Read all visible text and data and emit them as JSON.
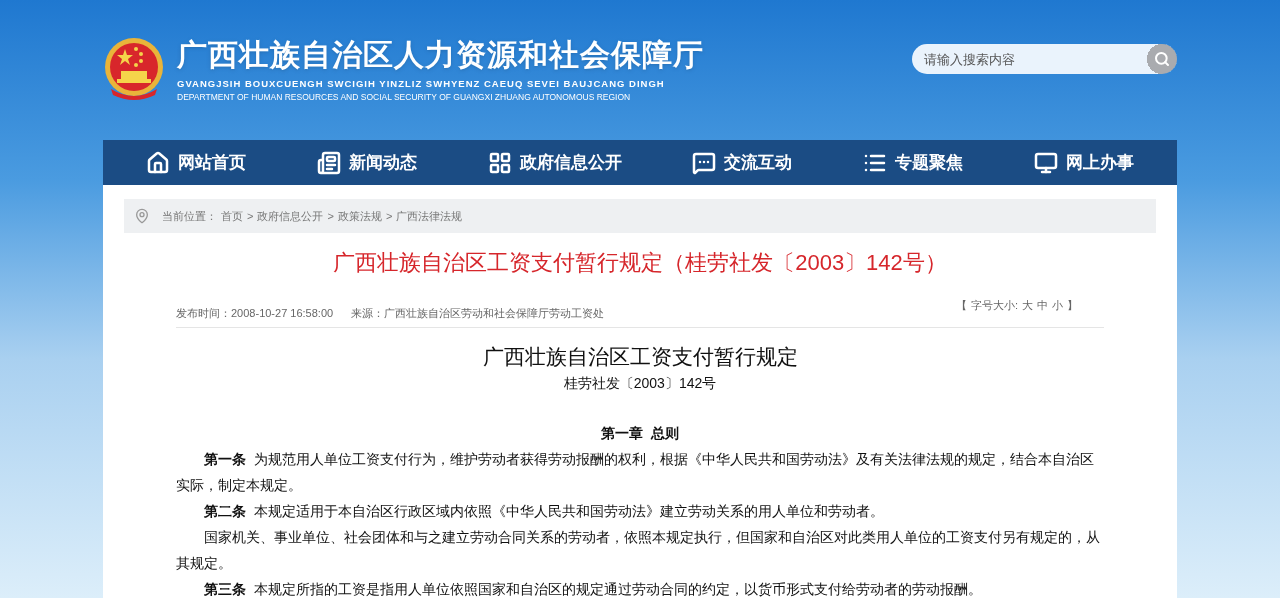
{
  "header": {
    "title": "广西壮族自治区人力资源和社会保障厅",
    "subtitle_zhuang": "GVANGJSIH BOUXCUENGH SWCIGIH YINZLIZ SWHYENZ CAEUQ SEVEI BAUJCANG DINGH",
    "subtitle_en": "DEPARTMENT OF HUMAN RESOURCES AND SOCIAL SECURITY OF GUANGXI ZHUANG AUTONOMOUS REGION"
  },
  "search": {
    "placeholder": "请输入搜索内容"
  },
  "nav": [
    {
      "label": "网站首页",
      "kind": "home"
    },
    {
      "label": "新闻动态",
      "kind": "news"
    },
    {
      "label": "政府信息公开",
      "kind": "grid"
    },
    {
      "label": "交流互动",
      "kind": "chat"
    },
    {
      "label": "专题聚焦",
      "kind": "list"
    },
    {
      "label": "网上办事",
      "kind": "monitor"
    }
  ],
  "breadcrumb": {
    "prefix": "当前位置：",
    "items": [
      {
        "label": "首页"
      },
      {
        "separator": ">",
        "label": "政府信息公开"
      },
      {
        "separator": ">",
        "label": "政策法规"
      },
      {
        "separator": ">",
        "label": "广西法律法规"
      }
    ]
  },
  "article": {
    "title": "广西壮族自治区工资支付暂行规定（桂劳社发〔2003〕142号）",
    "published": "发布时间：2008-10-27 16:58:00",
    "source": "来源：广西壮族自治区劳动和社会保障厅劳动工资处",
    "font_size": {
      "open": "【",
      "label": "字号大小:",
      "sizes": [
        "大",
        "中",
        "小"
      ],
      "close": "】"
    },
    "doc_title": "广西壮族自治区工资支付暂行规定",
    "doc_number": "桂劳社发〔2003〕142号",
    "chapter": "第一章  总则",
    "paragraphs": [
      {
        "text": "**第一条**  为规范用人单位工资支付行为，维护劳动者获得劳动报酬的权利，根据《中华人民共和国劳动法》及有关法律法规的规定，结合本自治区实际，制定本规定。"
      },
      {
        "text": "**第二条**  本规定适用于本自治区行政区域内依照《中华人民共和国劳动法》建立劳动关系的用人单位和劳动者。"
      },
      {
        "text": "国家机关、事业单位、社会团体和与之建立劳动合同关系的劳动者，依照本规定执行，但国家和自治区对此类用人单位的工资支付另有规定的，从其规定。"
      },
      {
        "text": "**第三条**  本规定所指的工资是指用人单位依照国家和自治区的规定通过劳动合同的约定，以货币形式支付给劳动者的劳动报酬。"
      }
    ]
  }
}
